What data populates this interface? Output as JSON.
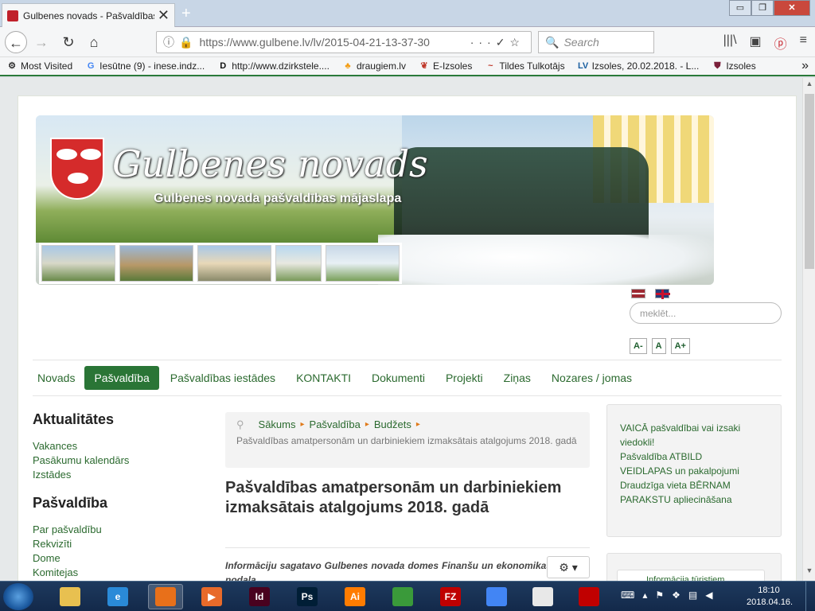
{
  "browser": {
    "tab_title": "Gulbenes novads - Pašvaldības",
    "tab_close": "✕",
    "new_tab": "+",
    "window_buttons": {
      "minimize": "▭",
      "maximize": "❐",
      "close": "✕"
    },
    "url": "https://www.gulbene.lv/lv/2015-04-21-13-37-30",
    "search_placeholder": "Search",
    "bookmarks": [
      {
        "label": "Most Visited",
        "icon": "gear-icon",
        "glyph": "⚙",
        "color": "#333333"
      },
      {
        "label": "Iesūtne (9) - inese.indz...",
        "icon": "google-icon",
        "glyph": "G",
        "color": "#4285f4"
      },
      {
        "label": "http://www.dzirkstele....",
        "icon": "d-logo-icon",
        "glyph": "D",
        "color": "#111111"
      },
      {
        "label": "draugiem.lv",
        "icon": "draugiem-icon",
        "glyph": "♣",
        "color": "#f39c12"
      },
      {
        "label": "E-Izsoles",
        "icon": "eizsoles-icon",
        "glyph": "❦",
        "color": "#c0392b"
      },
      {
        "label": "Tildes Tulkotājs",
        "icon": "tilde-icon",
        "glyph": "~",
        "color": "#c0392b"
      },
      {
        "label": "Izsoles, 20.02.2018. - L...",
        "icon": "lv-icon",
        "glyph": "LV",
        "color": "#1a5fa0"
      },
      {
        "label": "Izsoles",
        "icon": "shield-icon",
        "glyph": "⛊",
        "color": "#7a1f3a"
      }
    ],
    "bookmarks_more": "»"
  },
  "site": {
    "banner_title": "Gulbenes novads",
    "banner_subtitle": "Gulbenes novada pašvaldības mājaslapa",
    "search_placeholder": "meklēt...",
    "font_sizes": [
      "A-",
      "A",
      "A+"
    ],
    "nav": [
      {
        "label": "Novads",
        "active": false
      },
      {
        "label": "Pašvaldība",
        "active": true
      },
      {
        "label": "Pašvaldības iestādes",
        "active": false
      },
      {
        "label": "KONTAKTI",
        "active": false
      },
      {
        "label": "Dokumenti",
        "active": false
      },
      {
        "label": "Projekti",
        "active": false
      },
      {
        "label": "Ziņas",
        "active": false
      },
      {
        "label": "Nozares / jomas",
        "active": false
      }
    ],
    "accent_color": "#2a7536"
  },
  "sidebar": {
    "section1_title": "Aktualitātes",
    "section1_links": [
      "Vakances",
      "Pasākumu kalendārs",
      "Izstādes"
    ],
    "section2_title": "Pašvaldība",
    "section2_links": [
      "Par pašvaldību",
      "Rekvizīti",
      "Dome",
      "Komitejas"
    ]
  },
  "breadcrumb": {
    "items": [
      "Sākums",
      "Pašvaldība",
      "Budžets"
    ],
    "current": "Pašvaldības amatpersonām un darbiniekiem izmaksātais atalgojums 2018. gadā"
  },
  "article": {
    "title": "Pašvaldības amatpersonām un darbiniekiem izmaksātais atalgojums 2018. gadā",
    "intro": "Informāciju sagatavo Gulbenes novada domes Finanšu un ekonomikas nodaļa"
  },
  "right_box": {
    "lines": [
      "VAICĀ pašvaldībai vai izsaki viedokli!",
      "Pašvaldība ATBILD",
      "VEIDLAPAS un pakalpojumi",
      "Draudzīga vieta BĒRNAM",
      "PARAKSTU apliecināšana"
    ],
    "second_box_text": "Informācija tūristiem"
  },
  "taskbar": {
    "apps": [
      {
        "name": "explorer",
        "label": "",
        "color": "#e8c050"
      },
      {
        "name": "ie",
        "label": "e",
        "color": "#2a8ad8"
      },
      {
        "name": "firefox",
        "label": "",
        "color": "#e8701a"
      },
      {
        "name": "media-player",
        "label": "▶",
        "color": "#e86a2a"
      },
      {
        "name": "indesign",
        "label": "Id",
        "color": "#49021f"
      },
      {
        "name": "photoshop",
        "label": "Ps",
        "color": "#001e36"
      },
      {
        "name": "illustrator",
        "label": "Ai",
        "color": "#ff7c00"
      },
      {
        "name": "messenger",
        "label": "",
        "color": "#3a9a3a"
      },
      {
        "name": "filezilla",
        "label": "FZ",
        "color": "#bf0000"
      },
      {
        "name": "chrome",
        "label": "",
        "color": "#4285f4"
      },
      {
        "name": "document",
        "label": "",
        "color": "#e8e8e8"
      },
      {
        "name": "acrobat",
        "label": "",
        "color": "#c00000"
      }
    ],
    "time": "18:10",
    "date": "2018.04.16."
  }
}
